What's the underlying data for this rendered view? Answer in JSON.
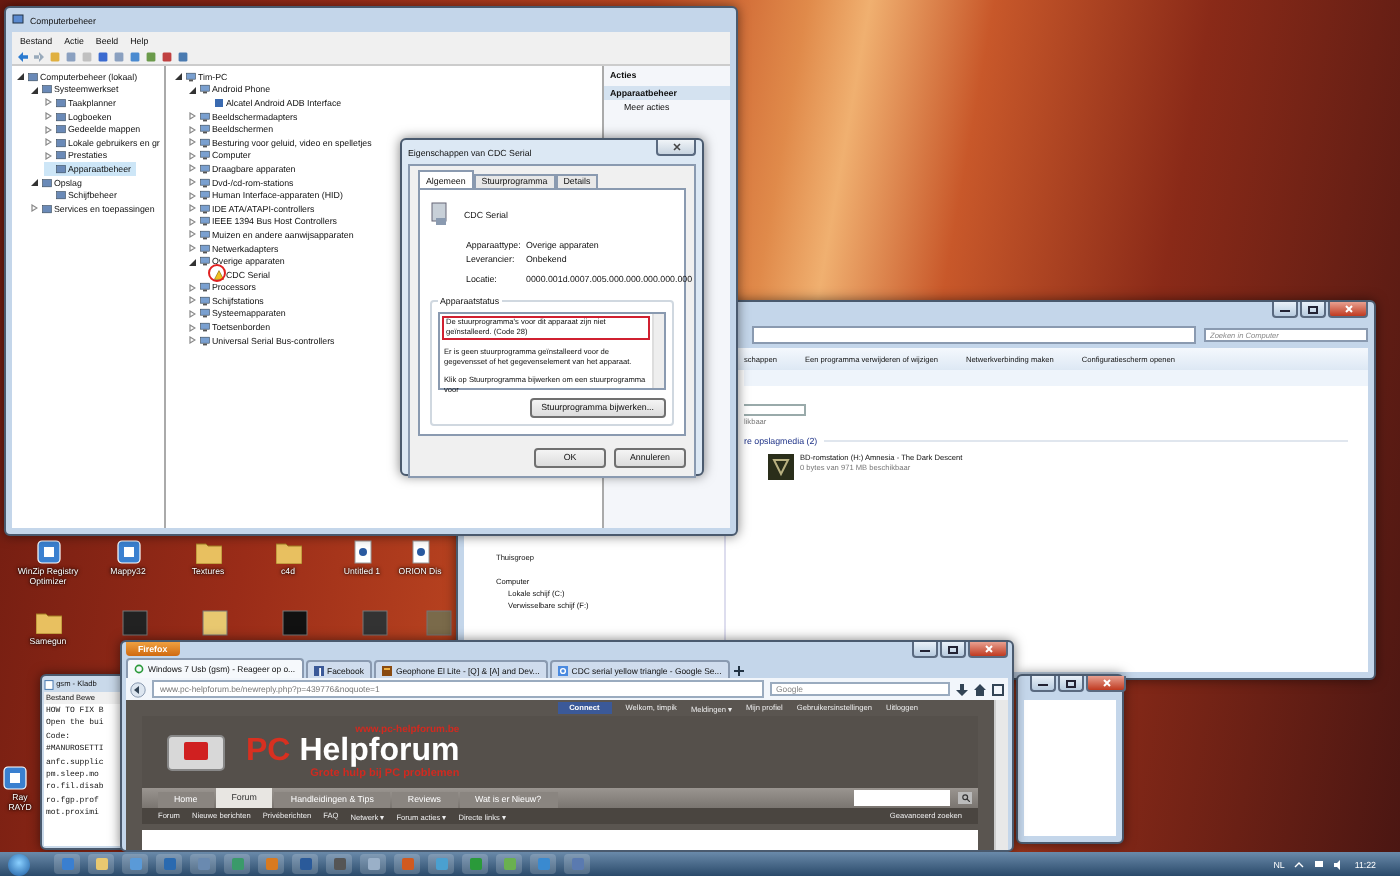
{
  "computer_management": {
    "title": "Computerbeheer",
    "menu": [
      "Bestand",
      "Actie",
      "Beeld",
      "Help"
    ],
    "nav_tree": [
      {
        "label": "Computerbeheer (lokaal)",
        "expanded": true,
        "selected": false,
        "children": [
          {
            "label": "Systeemwerkset",
            "expanded": true,
            "selected": false,
            "children": [
              {
                "label": "Taakplanner",
                "expanded": false,
                "selected": false
              },
              {
                "label": "Logboeken",
                "expanded": false,
                "selected": false
              },
              {
                "label": "Gedeelde mappen",
                "expanded": false,
                "selected": false
              },
              {
                "label": "Lokale gebruikers en gr",
                "expanded": false,
                "selected": false
              },
              {
                "label": "Prestaties",
                "expanded": false,
                "selected": false
              },
              {
                "label": "Apparaatbeheer",
                "selected": true
              }
            ]
          },
          {
            "label": "Opslag",
            "expanded": true,
            "selected": false,
            "children": [
              {
                "label": "Schijfbeheer",
                "selected": false
              }
            ]
          },
          {
            "label": "Services en toepassingen",
            "expanded": false,
            "selected": false
          }
        ]
      }
    ],
    "device_tree": [
      {
        "label": "Tim-PC",
        "expanded": true,
        "children": [
          {
            "label": "Android Phone",
            "expanded": true,
            "children": [
              {
                "label": "Alcatel Android ADB Interface",
                "warning": false
              }
            ]
          },
          {
            "label": "Beeldschermadapters",
            "expanded": false
          },
          {
            "label": "Beeldschermen",
            "expanded": false
          },
          {
            "label": "Besturing voor geluid, video en spelletjes",
            "expanded": false
          },
          {
            "label": "Computer",
            "expanded": false
          },
          {
            "label": "Draagbare apparaten",
            "expanded": false
          },
          {
            "label": "Dvd-/cd-rom-stations",
            "expanded": false
          },
          {
            "label": "Human Interface-apparaten (HID)",
            "expanded": false
          },
          {
            "label": "IDE ATA/ATAPI-controllers",
            "expanded": false
          },
          {
            "label": "IEEE 1394 Bus Host Controllers",
            "expanded": false
          },
          {
            "label": "Muizen en andere aanwijsapparaten",
            "expanded": false
          },
          {
            "label": "Netwerkadapters",
            "expanded": false
          },
          {
            "label": "Overige apparaten",
            "expanded": true,
            "children": [
              {
                "label": "CDC Serial",
                "warning": true
              }
            ]
          },
          {
            "label": "Processors",
            "expanded": false
          },
          {
            "label": "Schijfstations",
            "expanded": false
          },
          {
            "label": "Systeemapparaten",
            "expanded": false
          },
          {
            "label": "Toetsenborden",
            "expanded": false
          },
          {
            "label": "Universal Serial Bus-controllers",
            "expanded": false
          }
        ]
      }
    ],
    "actions": {
      "title": "Acties",
      "section": "Apparaatbeheer",
      "items": [
        "Meer acties"
      ]
    }
  },
  "properties_dialog": {
    "title": "Eigenschappen van CDC Serial",
    "tabs": [
      {
        "label": "Algemeen",
        "selected": true
      },
      {
        "label": "Stuurprogramma",
        "selected": false
      },
      {
        "label": "Details",
        "selected": false
      }
    ],
    "device_name": "CDC Serial",
    "fields": [
      {
        "label": "Apparaattype:",
        "value": "Overige apparaten"
      },
      {
        "label": "Leverancier:",
        "value": "Onbekend"
      },
      {
        "label": "Locatie:",
        "value": "0000.001d.0007.005.000.000.000.000.000"
      }
    ],
    "status_title": "Apparaatstatus",
    "status_lines": [
      {
        "text": "De stuurprogramma's voor dit apparaat zijn niet geïnstalleerd. (Code 28)",
        "highlighted": true
      },
      {
        "text": "Er is geen stuurprogramma geïnstalleerd voor de gegevensset of het gegevenselement van het apparaat.",
        "highlighted": false
      },
      {
        "text": "Klik op Stuurprogramma bijwerken om een stuurprogramma voor",
        "highlighted": false
      }
    ],
    "update_button": "Stuurprogramma bijwerken...",
    "buttons": [
      "OK",
      "Annuleren"
    ]
  },
  "explorer": {
    "search_placeholder": "Zoeken in Computer",
    "toolbar": [
      "schappen",
      "Een programma verwijderen of wijzigen",
      "Netwerkverbinding maken",
      "Configuratiescherm openen"
    ],
    "drive_free": "likbaar",
    "section": "re opslagmedia (2)",
    "drive": {
      "name": "BD-romstation (H:) Amnesia - The Dark Descent",
      "free": "0 bytes van 971 MB beschikbaar"
    },
    "nav": [
      {
        "label": "Thuisgroep",
        "kind": "group"
      },
      {
        "label": "Computer",
        "kind": "group"
      },
      {
        "label": "Lokale schijf (C:)",
        "kind": "drive"
      },
      {
        "label": "Verwisselbare schijf (F:)",
        "kind": "drive"
      }
    ]
  },
  "desktop_icons": [
    {
      "label": "WinZip Registry Optimizer",
      "kind": "app"
    },
    {
      "label": "Mappy32",
      "kind": "app"
    },
    {
      "label": "Textures",
      "kind": "folder"
    },
    {
      "label": "c4d",
      "kind": "folder"
    },
    {
      "label": "Untitled 1",
      "kind": "document"
    },
    {
      "label": "ORION Dis",
      "kind": "document"
    },
    {
      "label": "Samegun",
      "kind": "folder"
    },
    {
      "label": "Ray RAYD",
      "kind": "app"
    }
  ],
  "notepad": {
    "title": "gsm - Kladb",
    "menu": "Bestand Bewe",
    "lines": [
      "HOW TO FIX B",
      "Open the bui",
      "Code:",
      "#MANUROSETTI",
      "anfc.supplic",
      "pm.sleep.mo",
      "ro.fil.disab",
      "ro.fgp.prof",
      "mot.proximi"
    ]
  },
  "browser": {
    "menu_button": "Firefox",
    "tabs": [
      {
        "label": "Windows 7 Usb (gsm) - Reageer op o...",
        "selected": true,
        "kind": "loading"
      },
      {
        "label": "Facebook",
        "selected": false,
        "kind": "facebook"
      },
      {
        "label": "Geophone El Lite - [Q] & [A] and Dev...",
        "selected": false,
        "kind": "site"
      },
      {
        "label": "CDC serial yellow triangle - Google Se...",
        "selected": false,
        "kind": "google"
      }
    ],
    "url": "www.pc-helpforum.be/newreply.php?p=439776&noquote=1",
    "search_placeholder": "Google",
    "page": {
      "connect_button": "Connect",
      "user_links": [
        "Welkom, timpik",
        "Meldingen ▾",
        "Mijn profiel",
        "Gebruikersinstellingen",
        "Uitloggen"
      ],
      "site_url": "www.pc-helpforum.be",
      "logo_prefix": "PC",
      "logo_name": "Helpforum",
      "slogan": "Grote hulp bij PC problemen",
      "nav_tabs": [
        {
          "label": "Home",
          "selected": false
        },
        {
          "label": "Forum",
          "selected": true
        },
        {
          "label": "Handleidingen & Tips",
          "selected": false
        },
        {
          "label": "Reviews",
          "selected": false
        },
        {
          "label": "Wat is er Nieuw?",
          "selected": false
        }
      ],
      "sub_links": [
        "Forum",
        "Nieuwe berichten",
        "Privéberichten",
        "FAQ",
        "Netwerk ▾",
        "Forum acties ▾",
        "Directe links ▾"
      ],
      "advanced_search": "Geavanceerd zoeken"
    }
  },
  "taskbar": {
    "language": "NL",
    "clock": "11:22"
  }
}
